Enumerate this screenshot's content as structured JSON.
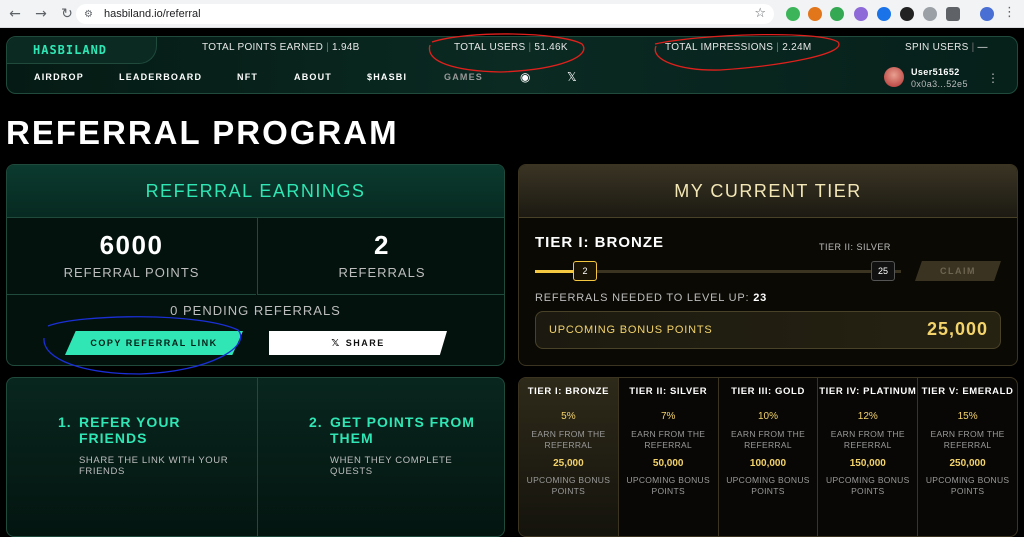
{
  "browser": {
    "url": "hasbiland.io/referral",
    "back": "←",
    "forward": "→",
    "reload": "↻",
    "tune": "⚙",
    "star": "☆",
    "menu": "⋮"
  },
  "header": {
    "logo": "HASBILAND",
    "stats": [
      {
        "label": "TOTAL POINTS EARNED",
        "value": "1.94B"
      },
      {
        "label": "TOTAL USERS",
        "value": "51.46K"
      },
      {
        "label": "TOTAL IMPRESSIONS",
        "value": "2.24M"
      },
      {
        "label": "SPIN USERS",
        "value": "—"
      }
    ],
    "sep": "|",
    "nav": [
      "AIRDROP",
      "LEADERBOARD",
      "NFT",
      "ABOUT",
      "$HASBI",
      "GAMES"
    ],
    "discord_glyph": "◉",
    "x_glyph": "𝕏",
    "user": {
      "name": "User51652",
      "address": "0x0a3...52e5"
    },
    "more": "⋮"
  },
  "page": {
    "title": "REFERRAL PROGRAM"
  },
  "earnings": {
    "title": "REFERRAL EARNINGS",
    "points": "6000",
    "points_label": "REFERRAL POINTS",
    "referrals": "2",
    "referrals_label": "REFERRALS",
    "pending": "0 PENDING REFERRALS",
    "copy_button": "COPY REFERRAL LINK",
    "share_glyph": "𝕏",
    "share_button": "SHARE"
  },
  "tier_card": {
    "title": "MY CURRENT TIER",
    "current": "TIER I: BRONZE",
    "next": "TIER II: SILVER",
    "progress_value": 2,
    "progress_max": 25,
    "progress_current_label": "2",
    "progress_max_label": "25",
    "claim": "CLAIM",
    "needed_label": "REFERRALS NEEDED TO LEVEL UP:",
    "needed_value": "23",
    "bonus_label": "UPCOMING BONUS POINTS",
    "bonus_value": "25,000"
  },
  "steps": [
    {
      "num": "1.",
      "title": "REFER YOUR FRIENDS",
      "desc": "SHARE THE LINK WITH YOUR FRIENDS"
    },
    {
      "num": "2.",
      "title": "GET POINTS FROM THEM",
      "desc": "WHEN THEY COMPLETE QUESTS"
    }
  ],
  "tiers": [
    {
      "name": "TIER I: BRONZE",
      "percent": "5%",
      "earn": "EARN FROM THE REFERRAL",
      "bonus": "25,000",
      "bonus_label": "UPCOMING BONUS POINTS"
    },
    {
      "name": "TIER II: SILVER",
      "percent": "7%",
      "earn": "EARN FROM THE REFERRAL",
      "bonus": "50,000",
      "bonus_label": "UPCOMING BONUS POINTS"
    },
    {
      "name": "TIER III: GOLD",
      "percent": "10%",
      "earn": "EARN FROM THE REFERRAL",
      "bonus": "100,000",
      "bonus_label": "UPCOMING BONUS POINTS"
    },
    {
      "name": "TIER IV: PLATINUM",
      "percent": "12%",
      "earn": "EARN FROM THE REFERRAL",
      "bonus": "150,000",
      "bonus_label": "UPCOMING BONUS POINTS"
    },
    {
      "name": "TIER V: EMERALD",
      "percent": "15%",
      "earn": "EARN FROM THE REFERRAL",
      "bonus": "250,000",
      "bonus_label": "UPCOMING BONUS POINTS"
    }
  ],
  "colors": {
    "accent": "#2fe6b4",
    "gold": "#f3d36b",
    "annotation_red": "#e0201c",
    "annotation_blue": "#1a2fd6"
  }
}
